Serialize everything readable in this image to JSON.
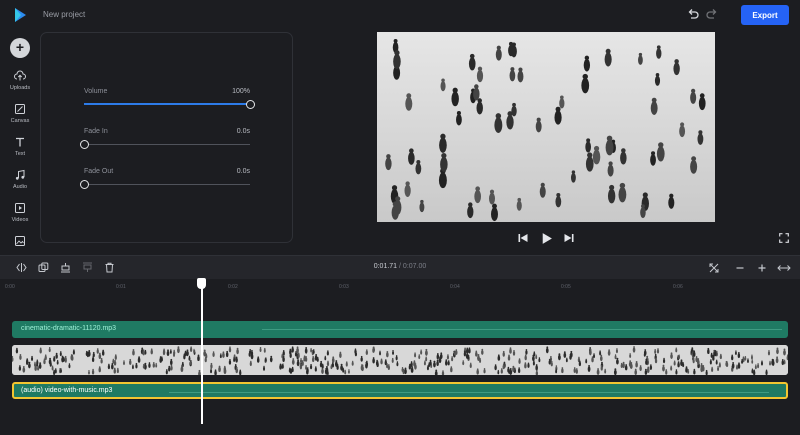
{
  "header": {
    "project_title": "New project",
    "export_label": "Export",
    "accent": "#2563f5"
  },
  "rail": {
    "add_icon": "plus-icon",
    "items": [
      {
        "label": "Uploads",
        "icon": "cloud-upload-icon"
      },
      {
        "label": "Canvas",
        "icon": "canvas-icon"
      },
      {
        "label": "Text",
        "icon": "text-icon"
      },
      {
        "label": "Audio",
        "icon": "music-note-icon"
      },
      {
        "label": "Videos",
        "icon": "video-icon"
      },
      {
        "label": "",
        "icon": "image-icon"
      }
    ]
  },
  "audio_settings": {
    "volume": {
      "label": "Volume",
      "value": "100%",
      "level": 1.0
    },
    "fade_in": {
      "label": "Fade In",
      "value": "0.0s",
      "level": 0.0
    },
    "fade_out": {
      "label": "Fade Out",
      "value": "0.0s",
      "level": 0.0
    }
  },
  "player": {
    "controls": [
      "skip-back-icon",
      "play-icon",
      "skip-forward-icon",
      "fullscreen-icon"
    ]
  },
  "timeline": {
    "current_time": "0:01.71",
    "separator": " / ",
    "duration": "0:07.00",
    "ruler_ticks": [
      "0:00",
      "0:01",
      "0:02",
      "0:03",
      "0:04",
      "0:05",
      "0:06"
    ],
    "tracks": {
      "music": "cinematic-dramatic-11120.mp3",
      "audio": "(audio) video-with-music.mp3"
    },
    "track_color": "#1f7a63",
    "selected_color": "#f2c531"
  }
}
